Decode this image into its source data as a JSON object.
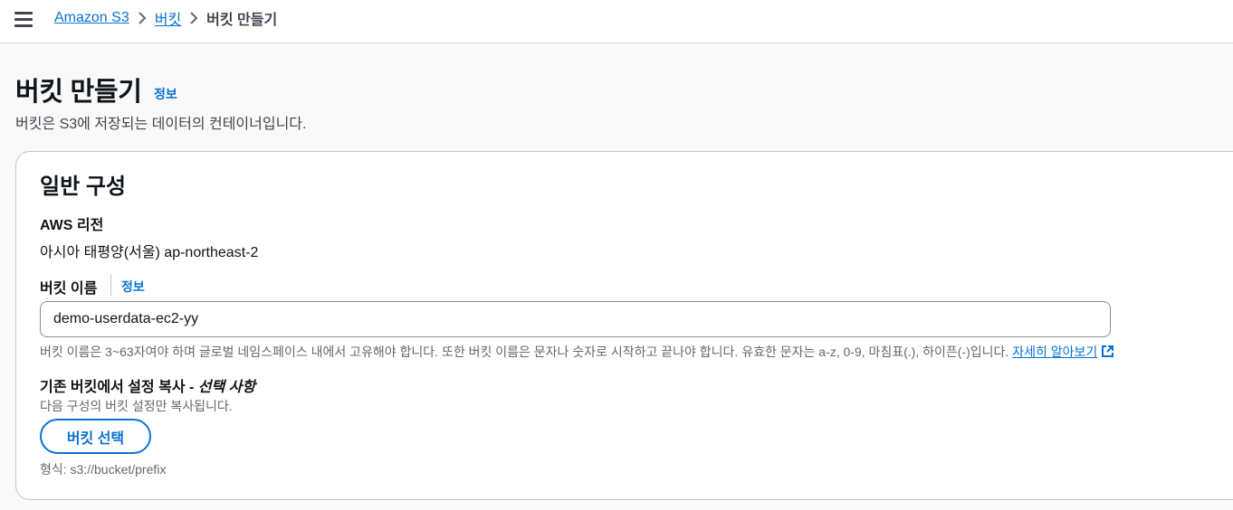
{
  "breadcrumb": {
    "items": [
      "Amazon S3",
      "버킷"
    ],
    "current": "버킷 만들기"
  },
  "page": {
    "title": "버킷 만들기",
    "info_link": "정보",
    "description": "버킷은 S3에 저장되는 데이터의 컨테이너입니다."
  },
  "general_config": {
    "title": "일반 구성",
    "region_label": "AWS 리전",
    "region_value": "아시아 태평양(서울) ap-northeast-2",
    "bucket_name_label": "버킷 이름",
    "bucket_name_info": "정보",
    "bucket_name_value": "demo-userdata-ec2-yy",
    "bucket_name_hint": "버킷 이름은 3~63자여야 하며 글로벌 네임스페이스 내에서 고유해야 합니다. 또한 버킷 이름은 문자나 숫자로 시작하고 끝나야 합니다. 유효한 문자는 a-z, 0-9, 마침표(.), 하이픈(-)입니다.",
    "learn_more": "자세히 알아보기",
    "copy_label_main": "기존 버킷에서 설정 복사 - ",
    "copy_label_optional": "선택 사항",
    "copy_desc": "다음 구성의 버킷 설정만 복사됩니다.",
    "select_button": "버킷 선택",
    "format_hint": "형식: s3://bucket/prefix"
  },
  "icons": {
    "menu": "hamburger-menu-icon",
    "separator": "chevron-right-icon",
    "external": "external-link-icon"
  },
  "colors": {
    "link": "#0972d3",
    "text": "#0f141a",
    "muted": "#656871",
    "page_bg": "#f9f9fa"
  }
}
